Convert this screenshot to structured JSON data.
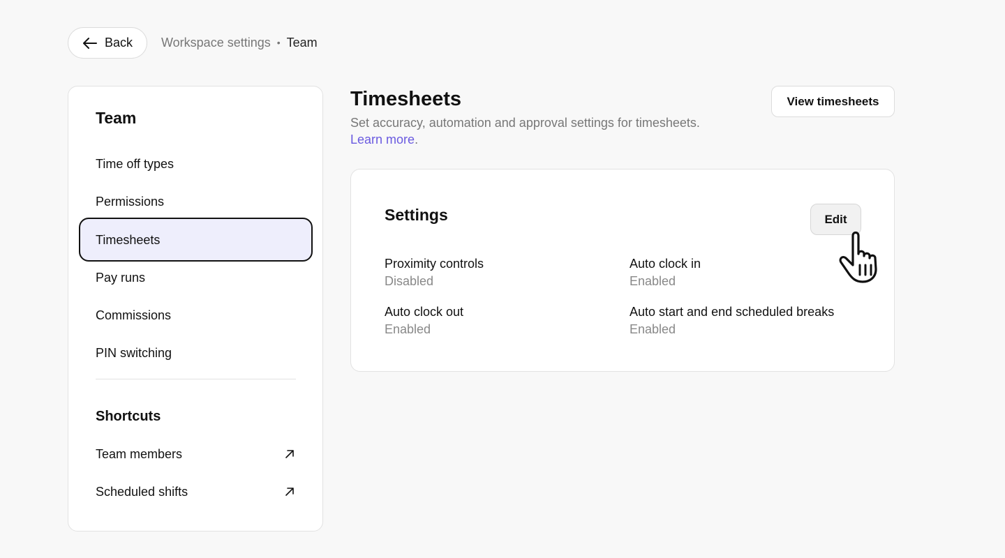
{
  "top": {
    "back_label": "Back",
    "breadcrumb_parent": "Workspace settings",
    "breadcrumb_sep": "•",
    "breadcrumb_current": "Team"
  },
  "sidebar": {
    "title": "Team",
    "items": [
      {
        "label": "Time off types"
      },
      {
        "label": "Permissions"
      },
      {
        "label": "Timesheets",
        "active": true
      },
      {
        "label": "Pay runs"
      },
      {
        "label": "Commissions"
      },
      {
        "label": "PIN switching"
      }
    ],
    "shortcuts_title": "Shortcuts",
    "shortcuts": [
      {
        "label": "Team members",
        "icon": "external-link-arrow-icon"
      },
      {
        "label": "Scheduled shifts",
        "icon": "external-link-arrow-icon"
      }
    ]
  },
  "main": {
    "title": "Timesheets",
    "description": "Set accuracy, automation and approval settings for timesheets.",
    "learn_more": "Learn more",
    "learn_more_dot": ".",
    "view_button": "View timesheets",
    "card": {
      "title": "Settings",
      "edit_button": "Edit",
      "settings": [
        {
          "label": "Proximity controls",
          "value": "Disabled"
        },
        {
          "label": "Auto clock in",
          "value": "Enabled"
        },
        {
          "label": "Auto clock out",
          "value": "Enabled"
        },
        {
          "label": "Auto start and end scheduled breaks",
          "value": "Enabled"
        }
      ]
    }
  },
  "colors": {
    "accent_link": "#6a5ae0",
    "active_bg": "#eeeefc",
    "page_bg": "#f8f8f8"
  }
}
